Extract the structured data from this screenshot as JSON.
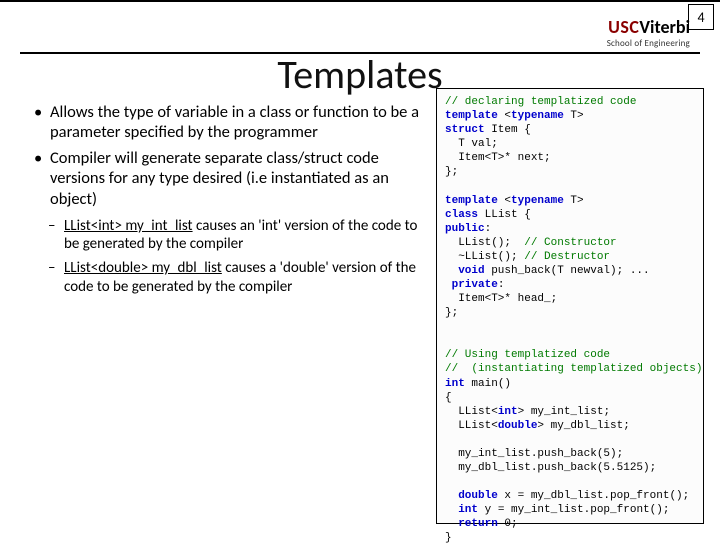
{
  "page_number": "4",
  "logo": {
    "usc": "USC",
    "viterbi": "Viterbi",
    "sub": "School of Engineering"
  },
  "title": "Templates",
  "bullets": [
    "Allows the type of variable in a class or function to be a parameter specified by the programmer",
    "Compiler will generate separate class/struct code versions for any type desired (i.e instantiated as an object)"
  ],
  "subs": [
    {
      "u": "LList<int> my_int_list",
      "rest": " causes an 'int' version of the code to be generated by the compiler"
    },
    {
      "u": "LList<double> my_dbl_list",
      "rest": " causes a 'double' version of the code to be generated by the compiler"
    }
  ],
  "code": {
    "c1": "// declaring templatized code",
    "l1a": "template",
    "l1b": " <",
    "l1c": "typename",
    "l1d": " T>",
    "l2a": "struct",
    "l2b": " Item {",
    "l3": "  T val;",
    "l4": "  Item<T>* next;",
    "l5": "};",
    "l6a": "template",
    "l6b": " <",
    "l6c": "typename",
    "l6d": " T>",
    "l7a": "class",
    "l7b": " LList {",
    "l8a": "public",
    "l8b": ":",
    "l9a": "  LList();  ",
    "l9b": "// Constructor",
    "l10a": "  ~LList(); ",
    "l10b": "// Destructor",
    "l11a": "  ",
    "l11b": "void",
    "l11c": " push_back(T newval); ...",
    "l12a": " private",
    "l12b": ":",
    "l13": "  Item<T>* head_;",
    "l14": "};",
    "c2a": "// Using templatized code",
    "c2b": "//  (instantiating templatized objects)",
    "l15a": "int",
    "l15b": " main()",
    "l16": "{",
    "l17a": "  LList<",
    "l17b": "int",
    "l17c": "> my_int_list;",
    "l18a": "  LList<",
    "l18b": "double",
    "l18c": "> my_dbl_list;",
    "l19": "  my_int_list.push_back(5);",
    "l20": "  my_dbl_list.push_back(5.5125);",
    "l21a": "  ",
    "l21b": "double",
    "l21c": " x = my_dbl_list.pop_front();",
    "l22a": "  ",
    "l22b": "int",
    "l22c": " y = my_int_list.pop_front();",
    "l23a": "  ",
    "l23b": "return",
    "l23c": " 0;",
    "l24": "}"
  }
}
